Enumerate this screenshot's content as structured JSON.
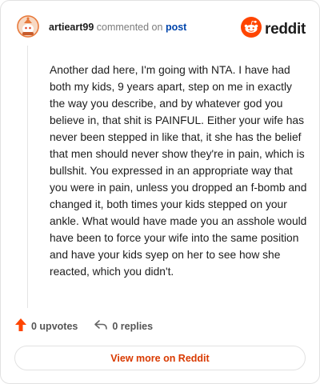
{
  "comment": {
    "username": "artieart99",
    "action_text": "commented on",
    "target_link": "post",
    "body": "Another dad here, I'm going with NTA. I have had both my kids, 9 years apart, step on me in exactly the way you describe, and by whatever god you believe in, that shit is PAINFUL. Either your wife has never been stepped in like that, it she has the belief that men should never show they're in pain, which is bullshit. You expressed in an appropriate way that you were in pain, unless you dropped an f-bomb and changed it, both times your kids stepped on your ankle. What would have made you an asshole would have been to force your wife into the same position and have your kids syep on her to see how she reacted, which you didn't.",
    "upvotes_label": "0 upvotes",
    "replies_label": "0 replies"
  },
  "brand": {
    "name": "reddit",
    "accent_color": "#ff4500"
  },
  "footer": {
    "view_more_label": "View more on Reddit"
  },
  "icons": {
    "avatar": "snoo-avatar-icon",
    "logo": "reddit-logo-icon",
    "upvote": "upvote-arrow-icon",
    "reply": "reply-arrow-icon"
  }
}
